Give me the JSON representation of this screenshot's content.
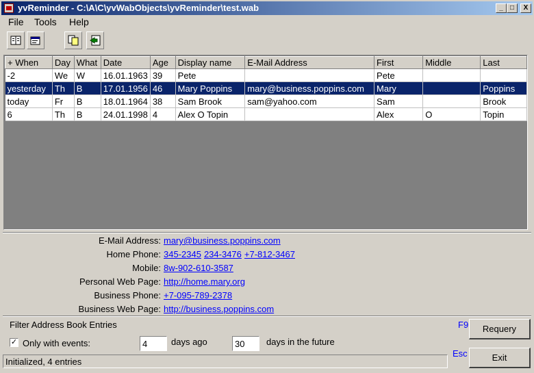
{
  "window": {
    "title": "yvReminder - C:\\A\\C\\yvWabObjects\\yvReminder\\test.wab",
    "min_glyph": "_",
    "max_glyph": "□",
    "close_glyph": "X"
  },
  "menu": {
    "file": "File",
    "tools": "Tools",
    "help": "Help"
  },
  "toolbar": {
    "buttons": [
      {
        "icon": "address-book-icon"
      },
      {
        "icon": "properties-icon"
      },
      {
        "icon": "copy-icon"
      },
      {
        "icon": "export-icon"
      }
    ]
  },
  "table": {
    "columns": [
      "+ When",
      "Day",
      "What",
      "Date",
      "Age",
      "Display name",
      "E-Mail Address",
      "First",
      "Middle",
      "Last"
    ],
    "rows": [
      {
        "when": "-2",
        "day": "We",
        "what": "W",
        "date": "16.01.1963",
        "age": "39",
        "display": "Pete",
        "email": "",
        "first": "Pete",
        "middle": "",
        "last": ""
      },
      {
        "when": "yesterday",
        "day": "Th",
        "what": "B",
        "date": "17.01.1956",
        "age": "46",
        "display": "Mary Poppins",
        "email": "mary@business.poppins.com",
        "first": "Mary",
        "middle": "",
        "last": "Poppins"
      },
      {
        "when": "today",
        "day": "Fr",
        "what": "B",
        "date": "18.01.1964",
        "age": "38",
        "display": "Sam Brook",
        "email": "sam@yahoo.com",
        "first": "Sam",
        "middle": "",
        "last": "Brook"
      },
      {
        "when": "6",
        "day": "Th",
        "what": "B",
        "date": "24.01.1998",
        "age": "4",
        "display": "Alex O Topin",
        "email": "",
        "first": "Alex",
        "middle": "O",
        "last": "Topin"
      }
    ],
    "selected_index": 1
  },
  "details": {
    "email_label": "E-Mail Address:",
    "email": "mary@business.poppins.com",
    "home_phone_label": "Home Phone:",
    "home_phones": [
      "345-2345",
      "234-3476",
      "+7-812-3467"
    ],
    "mobile_label": "Mobile:",
    "mobile": "8w-902-610-3587",
    "personal_web_label": "Personal Web Page:",
    "personal_web": "http://home.mary.org",
    "business_phone_label": "Business Phone:",
    "business_phone": "+7-095-789-2378",
    "business_web_label": "Business Web Page:",
    "business_web": "http://business.poppins.com"
  },
  "filter": {
    "title": "Filter Address Book Entries",
    "only_events_label": "Only with events:",
    "only_events_checked": "✓",
    "days_ago_value": "4",
    "days_ago_label": "days ago",
    "days_future_value": "30",
    "days_future_label": "days in the future"
  },
  "buttons": {
    "requery": "Requery",
    "requery_key": "F9",
    "exit": "Exit",
    "exit_key": "Esc"
  },
  "status": "Initialized, 4 entries"
}
